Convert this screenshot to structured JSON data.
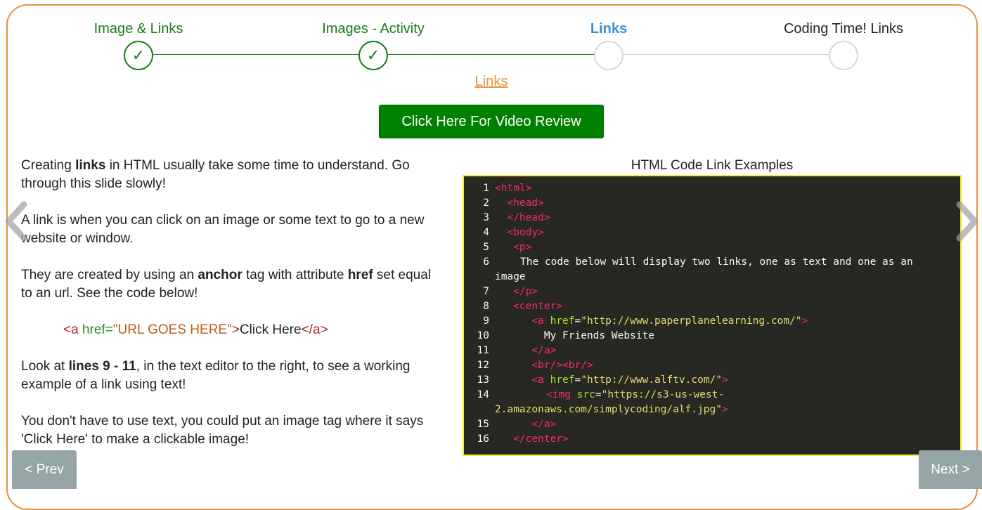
{
  "stepper": {
    "steps": [
      {
        "label": "Image & Links",
        "state": "done"
      },
      {
        "label": "Images - Activity",
        "state": "done"
      },
      {
        "label": "Links",
        "state": "active"
      },
      {
        "label": "Coding Time! Links",
        "state": "todo"
      }
    ],
    "check_glyph": "✓"
  },
  "sub_link": "Links",
  "video_button": "Click Here For Video Review",
  "left": {
    "p1": {
      "a": "Creating ",
      "b": "links",
      "c": " in HTML usually take some time to understand. Go through this slide slowly!"
    },
    "p2": "A link is when you can click on an image or some text to go to a new website or window.",
    "p3": {
      "a": "They are created by using an ",
      "b": "anchor",
      "c": " tag with attribute ",
      "d": "href",
      "e": " set equal to an url. See the code below!"
    },
    "code_example": {
      "tag_open": "<a ",
      "attr": "href=",
      "value": "\"URL GOES HERE\"",
      "close_bracket": ">",
      "text": "Click Here",
      "tag_close": "</a>"
    },
    "p4": {
      "a": "Look at ",
      "b": "lines 9 - 11",
      "c": ", in the text editor to the right, to see a working example of a link using text!"
    },
    "p5": "You don't have to use text, you could put an image tag where it says 'Click Here' to make a clickable image!"
  },
  "code_title": "HTML Code Link Examples",
  "code_lines": {
    "l1": "<html>",
    "l2": "<head>",
    "l3": "</head>",
    "l4": "<body>",
    "l5": "<p>",
    "l6": "The code below will display two links, one as text and one as an image",
    "l7": "</p>",
    "l8": "<center>",
    "l9a": "<a ",
    "l9b": "href",
    "l9c": "=",
    "l9d": "\"http://www.paperplanelearning.com/\"",
    "l9e": ">",
    "l10": "My Friends Website",
    "l11": "</a>",
    "l12": "<br/><br/>",
    "l13a": "<a ",
    "l13b": "href",
    "l13c": "=",
    "l13d": "\"http://www.alftv.com/\"",
    "l13e": ">",
    "l14a": "<img ",
    "l14b": "src",
    "l14c": "=",
    "l14d": "\"https://s3-us-west-2.amazonaws.com/simplycoding/alf.jpg\"",
    "l14e": ">",
    "l15": "</a>",
    "l16": "</center>"
  },
  "nav": {
    "prev": "< Prev",
    "next": "Next >"
  },
  "colors": {
    "accent": "#e8913a",
    "done": "#1a7a1a",
    "active": "#3b8fd0",
    "video_button": "#008000",
    "code_border": "#f5ec2a",
    "nav_button": "#95a5a6"
  }
}
